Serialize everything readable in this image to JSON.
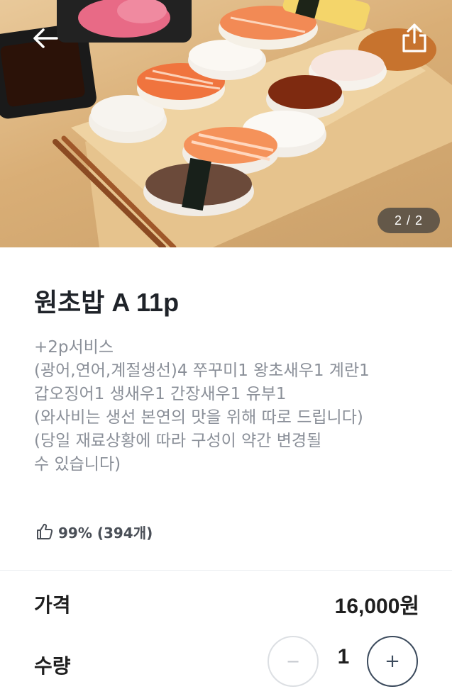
{
  "hero": {
    "image_alt": "Assorted nigiri sushi on a wooden board",
    "counter": "2 / 2"
  },
  "product": {
    "name": "원초밥 A 11p",
    "description_lines": [
      "+2p서비스",
      "(광어,연어,계절생선)4 쭈꾸미1 왕초새우1 계란1",
      "갑오징어1 생새우1 간장새우1 유부1",
      "(와사비는 생선 본연의 맛을 위해 따로 드립니다)",
      "(당일 재료상황에 따라 구성이 약간 변경될",
      "수 있습니다)"
    ],
    "rating": "99% (394개)"
  },
  "price": {
    "label": "가격",
    "value": "16,000원"
  },
  "quantity": {
    "label": "수량",
    "value": "1",
    "minus_symbol": "−",
    "plus_symbol": "+"
  },
  "icons": {
    "back": "back-arrow-icon",
    "share": "share-icon",
    "rating": "thumbs-up-icon"
  },
  "colors": {
    "title": "#1f2329",
    "description": "#8a8f98",
    "counter_bg": "#3c3c3c",
    "stepper_active": "#3b4a5c",
    "stepper_disabled": "#c3c7cd"
  }
}
